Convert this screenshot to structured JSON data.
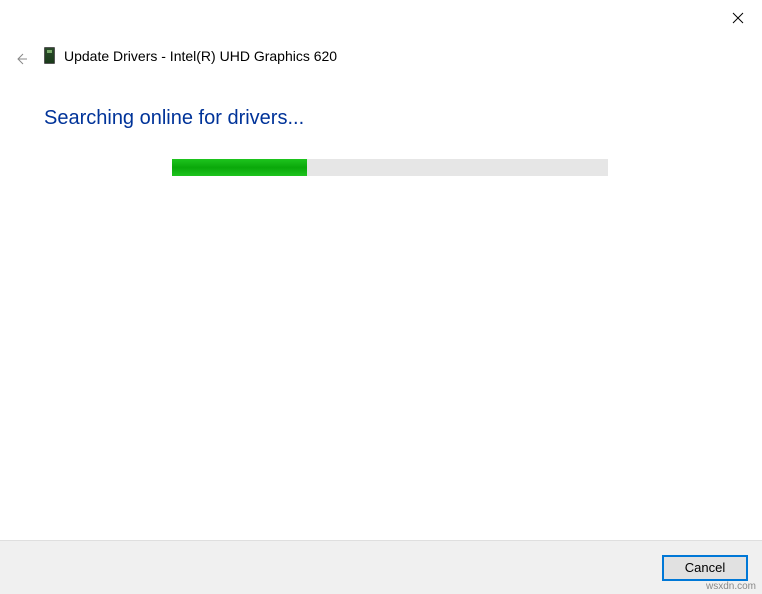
{
  "header": {
    "title": "Update Drivers - Intel(R) UHD Graphics 620"
  },
  "status": {
    "message": "Searching online for drivers..."
  },
  "progress": {
    "percent": 31
  },
  "footer": {
    "cancel_label": "Cancel"
  },
  "watermark": "wsxdn.com"
}
